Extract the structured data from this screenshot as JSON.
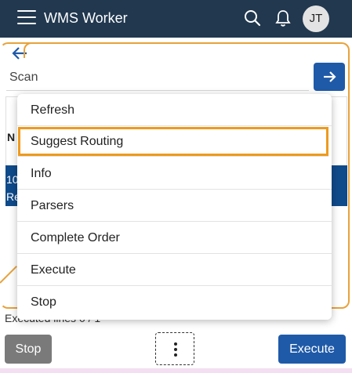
{
  "header": {
    "title": "WMS Worker",
    "avatar_initials": "JT",
    "icons": [
      "hamburger-icon",
      "search-icon",
      "bell-icon"
    ]
  },
  "scan": {
    "placeholder": "Scan"
  },
  "background_table": {
    "column_header_partial": "N",
    "selected_row_partial_1": "10",
    "selected_row_partial_2": "Re"
  },
  "status": {
    "executed_lines": "Executed lines 0 / 1"
  },
  "footer": {
    "stop_label": "Stop",
    "execute_label": "Execute"
  },
  "menu": {
    "items": [
      {
        "label": "Refresh"
      },
      {
        "label": "Suggest Routing"
      },
      {
        "label": "Info"
      },
      {
        "label": "Parsers"
      },
      {
        "label": "Complete Order"
      },
      {
        "label": "Execute"
      },
      {
        "label": "Stop"
      }
    ],
    "highlighted_index": 1
  },
  "colors": {
    "header_bg": "#21384f",
    "primary": "#1f5aa8",
    "highlight_outline": "#ee9a1e",
    "secondary_button": "#7a7a7a"
  }
}
